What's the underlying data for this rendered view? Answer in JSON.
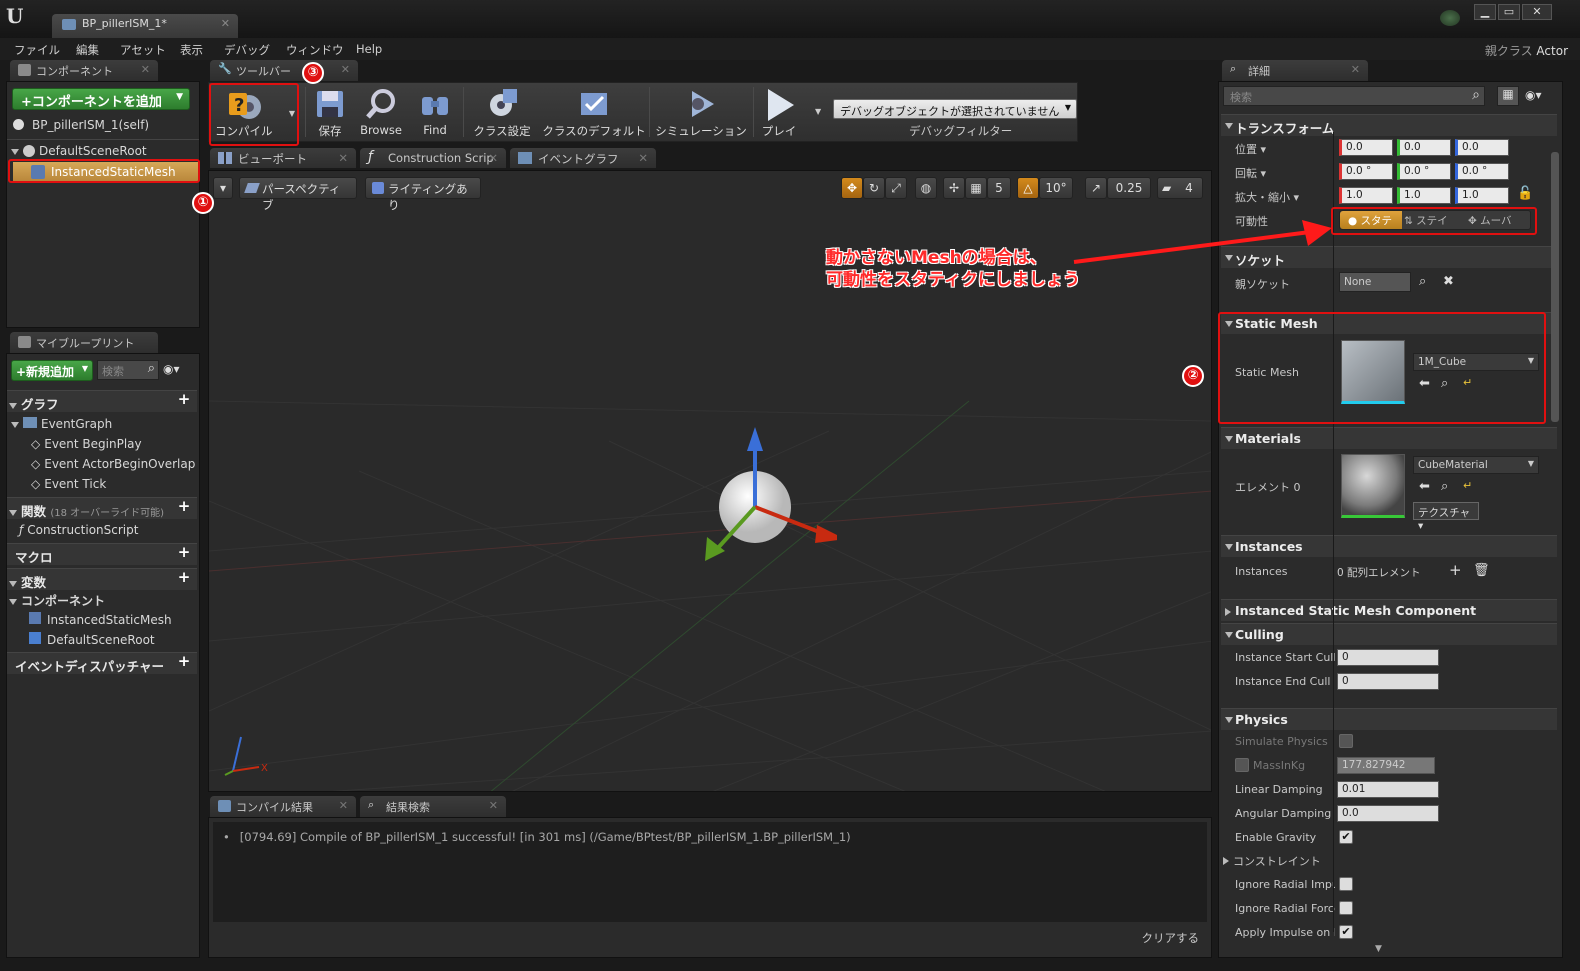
{
  "window": {
    "doc_tab": "BP_pillerISM_1*",
    "parent_class_prefix": "親クラス",
    "parent_class_value": "Actor",
    "minimize": "▁",
    "maximize": "▭",
    "close": "✕"
  },
  "menu": [
    "ファイル",
    "編集",
    "アセット",
    "表示",
    "デバッグ",
    "ウィンドウ",
    "Help"
  ],
  "components_panel": {
    "tab": "コンポーネント",
    "add_button": "+コンポーネントを追加",
    "self_item": "BP_pillerISM_1(self)",
    "root_item": "DefaultSceneRoot",
    "child_item": "InstancedStaticMesh"
  },
  "my_blueprint": {
    "tab": "マイブループリント",
    "new_button": "+新規追加",
    "search_placeholder": "検索",
    "graph_header": "グラフ",
    "event_graph": "EventGraph",
    "events": [
      "Event BeginPlay",
      "Event ActorBeginOverlap",
      "Event Tick"
    ],
    "functions_header": "関数",
    "functions_note": "(18 オーバーライド可能)",
    "construction_script": "ConstructionScript",
    "macros_header": "マクロ",
    "variables_header": "変数",
    "components_header": "コンポーネント",
    "component_items": [
      "InstancedStaticMesh",
      "DefaultSceneRoot"
    ],
    "dispatchers_header": "イベントディスパッチャー"
  },
  "toolbar": {
    "tab": "ツールバー",
    "compile": "コンパイル",
    "save": "保存",
    "browse": "Browse",
    "find": "Find",
    "class_settings": "クラス設定",
    "class_defaults": "クラスのデフォルト",
    "simulation": "シミュレーション",
    "play": "プレイ",
    "debug_dropdown": "デバッグオブジェクトが選択されていません",
    "debug_filter": "デバッグフィルター"
  },
  "editor_tabs": [
    "ビューポート",
    "Construction Scrip",
    "イベントグラフ"
  ],
  "viewport": {
    "perspective": "パースペクティブ",
    "lighting": "ライティングあり",
    "grid_snap": "5",
    "rot_snap": "10°",
    "scale_snap": "0.25",
    "cam_speed": "4",
    "axis_x": "X"
  },
  "output": {
    "tabs": [
      "コンパイル結果",
      "結果検索"
    ],
    "log_line": "[0794.69] Compile of BP_pillerISM_1 successful! [in 301 ms] (/Game/BPtest/BP_pillerISM_1.BP_pillerISM_1)",
    "clear_button": "クリアする"
  },
  "details": {
    "tab": "詳細",
    "search_placeholder": "検索",
    "transform_header": "トランスフォーム",
    "location_label": "位置",
    "rotation_label": "回転",
    "scale_label": "拡大・縮小",
    "location": [
      "0.0",
      "0.0",
      "0.0"
    ],
    "rotation": [
      "0.0 °",
      "0.0 °",
      "0.0 °"
    ],
    "scale": [
      "1.0",
      "1.0",
      "1.0"
    ],
    "mobility_label": "可動性",
    "mobility_options": [
      "スタテ",
      "ステイ",
      "ムーバ"
    ],
    "socket_header": "ソケット",
    "parent_socket_label": "親ソケット",
    "parent_socket_value": "None",
    "static_mesh_header": "Static Mesh",
    "static_mesh_label": "Static Mesh",
    "static_mesh_value": "1M_Cube",
    "materials_header": "Materials",
    "element0_label": "エレメント 0",
    "element0_value": "CubeMaterial",
    "texture_button": "テクスチャ",
    "instances_header": "Instances",
    "instances_label": "Instances",
    "instances_value": "0 配列エレメント",
    "ismc_header": "Instanced Static Mesh Component",
    "culling_header": "Culling",
    "cull_start_label": "Instance Start Cull D",
    "cull_start_value": "0",
    "cull_end_label": "Instance End Cull Di",
    "cull_end_value": "0",
    "physics_header": "Physics",
    "simulate_physics": "Simulate Physics",
    "mass_label": "MassInKg",
    "mass_value": "177.827942",
    "linear_damping_label": "Linear Damping",
    "linear_damping_value": "0.01",
    "angular_damping_label": "Angular Damping",
    "angular_damping_value": "0.0",
    "enable_gravity": "Enable Gravity",
    "constraints": "コンストレイント",
    "ignore_radial_impulse": "Ignore Radial Impuls",
    "ignore_radial_force": "Ignore Radial Force",
    "apply_impulse": "Apply Impulse on Da"
  },
  "annotations": {
    "num1": "①",
    "num2": "②",
    "num3": "③",
    "note_line1": "動かさないMeshの場合は、",
    "note_line2": "可動性をスタティクにしましょう"
  },
  "colors": {
    "accent_green": "#3a8f3a",
    "selection_orange": "#c8902a",
    "annotation_red": "#e01010"
  }
}
